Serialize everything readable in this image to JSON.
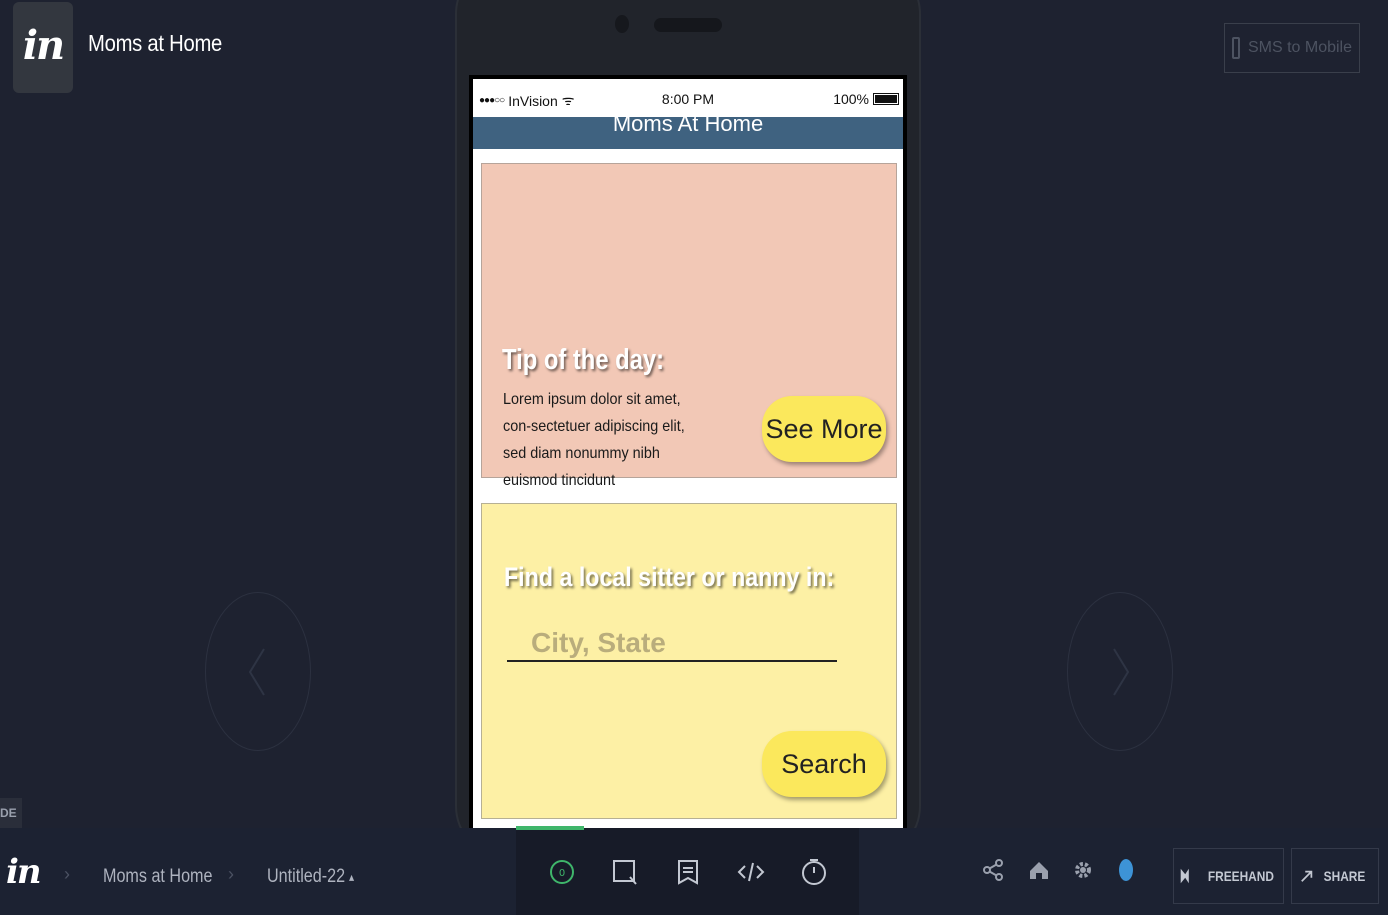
{
  "app": {
    "logo_text": "in",
    "title": "Moms at Home",
    "sms_button_label": "SMS to Mobile"
  },
  "phone": {
    "status": {
      "signal": "●●●○○",
      "carrier": "InVision",
      "wifi": "ᯤ",
      "time": "8:00 PM",
      "battery_pct": "100%"
    },
    "nav_title": "Moms At Home",
    "tip": {
      "heading": "Tip of the day:",
      "body": "Lorem ipsum dolor sit amet, con-sectetuer adipiscing elit, sed diam nonummy nibh euismod tincidunt",
      "button_label": "See More",
      "background_color": "#f2c8b6"
    },
    "finder": {
      "heading": "Find a local sitter or nanny in:",
      "input_placeholder": "City, State",
      "button_label": "Search",
      "background_color": "#fdf0a5"
    }
  },
  "nav_arrows": {
    "prev_glyph": "‹",
    "next_glyph": "›"
  },
  "side_tag": "DE",
  "toolbar": {
    "logo_text": "in",
    "breadcrumb": [
      "Moms at Home",
      "Untitled-22"
    ],
    "screen_dropdown_glyph": "▴",
    "preview_badge": "0",
    "tools": [
      "preview-icon",
      "comment-box-icon",
      "notes-icon",
      "code-icon",
      "history-icon"
    ],
    "right_icons": [
      "share-nodes-icon",
      "home-icon",
      "gear-icon",
      "status-dot"
    ],
    "freehand_label": "FREEHAND",
    "share_label": "SHARE",
    "accent_color": "#3fb66b",
    "status_dot_color": "#3d93d6"
  }
}
